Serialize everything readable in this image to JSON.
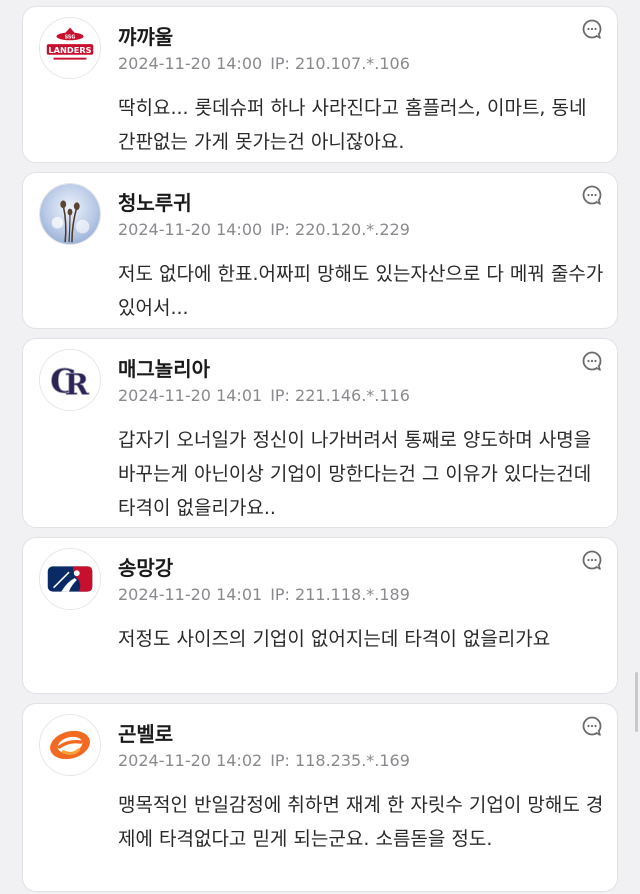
{
  "comments": [
    {
      "nickname": "꺄꺄울",
      "date": "2024-11-20 14:00",
      "ip": "IP: 210.107.*.106",
      "text": "딱히요... 롯데슈퍼 하나 사라진다고 홈플러스, 이마트, 동네 간판없는 가게 못가는건 아니잖아요.",
      "avatar_icon": "landers-logo-icon",
      "avatar_text": "LANDERS",
      "avatar_badge": "SSG"
    },
    {
      "nickname": "청노루귀",
      "date": "2024-11-20 14:00",
      "ip": "IP: 220.120.*.229",
      "text": "저도 없다에 한표.어짜피 망해도 있는자산으로 다 메꿔 줄수가있어서...",
      "avatar_icon": "flower-photo-icon"
    },
    {
      "nickname": "매그놀리아",
      "date": "2024-11-20 14:01",
      "ip": "IP: 221.146.*.116",
      "text": "갑자기 오너일가 정신이 나가버려서 통째로 양도하며 사명을 바꾸는게 아닌이상 기업이 망한다는건 그 이유가 있다는건데 타격이 없을리가요..",
      "avatar_icon": "rockies-logo-icon"
    },
    {
      "nickname": "송망강",
      "date": "2024-11-20 14:01",
      "ip": "IP: 211.118.*.189",
      "text": "저정도 사이즈의 기업이 없어지는데 타격이 없을리가요",
      "avatar_icon": "mlb-logo-icon"
    },
    {
      "nickname": "곤벨로",
      "date": "2024-11-20 14:02",
      "ip": "IP: 118.235.*.169",
      "text": "맹목적인 반일감정에 취하면 재계 한 자릿수 기업이 망해도 경제에 타격없다고 믿게 되는군요. 소름돋을 정도.",
      "avatar_icon": "e-logo-icon"
    }
  ],
  "reply_icon": "reply-bubble-icon",
  "colors": {
    "card_bg": "#ffffff",
    "page_bg": "#f1f1f3",
    "meta_text": "#8a8a8e",
    "landers_red": "#c8102e",
    "mlb_blue": "#0a2a66",
    "mlb_red": "#c8102e",
    "rockies_purple": "#2e2258",
    "e_orange": "#f26a21"
  }
}
